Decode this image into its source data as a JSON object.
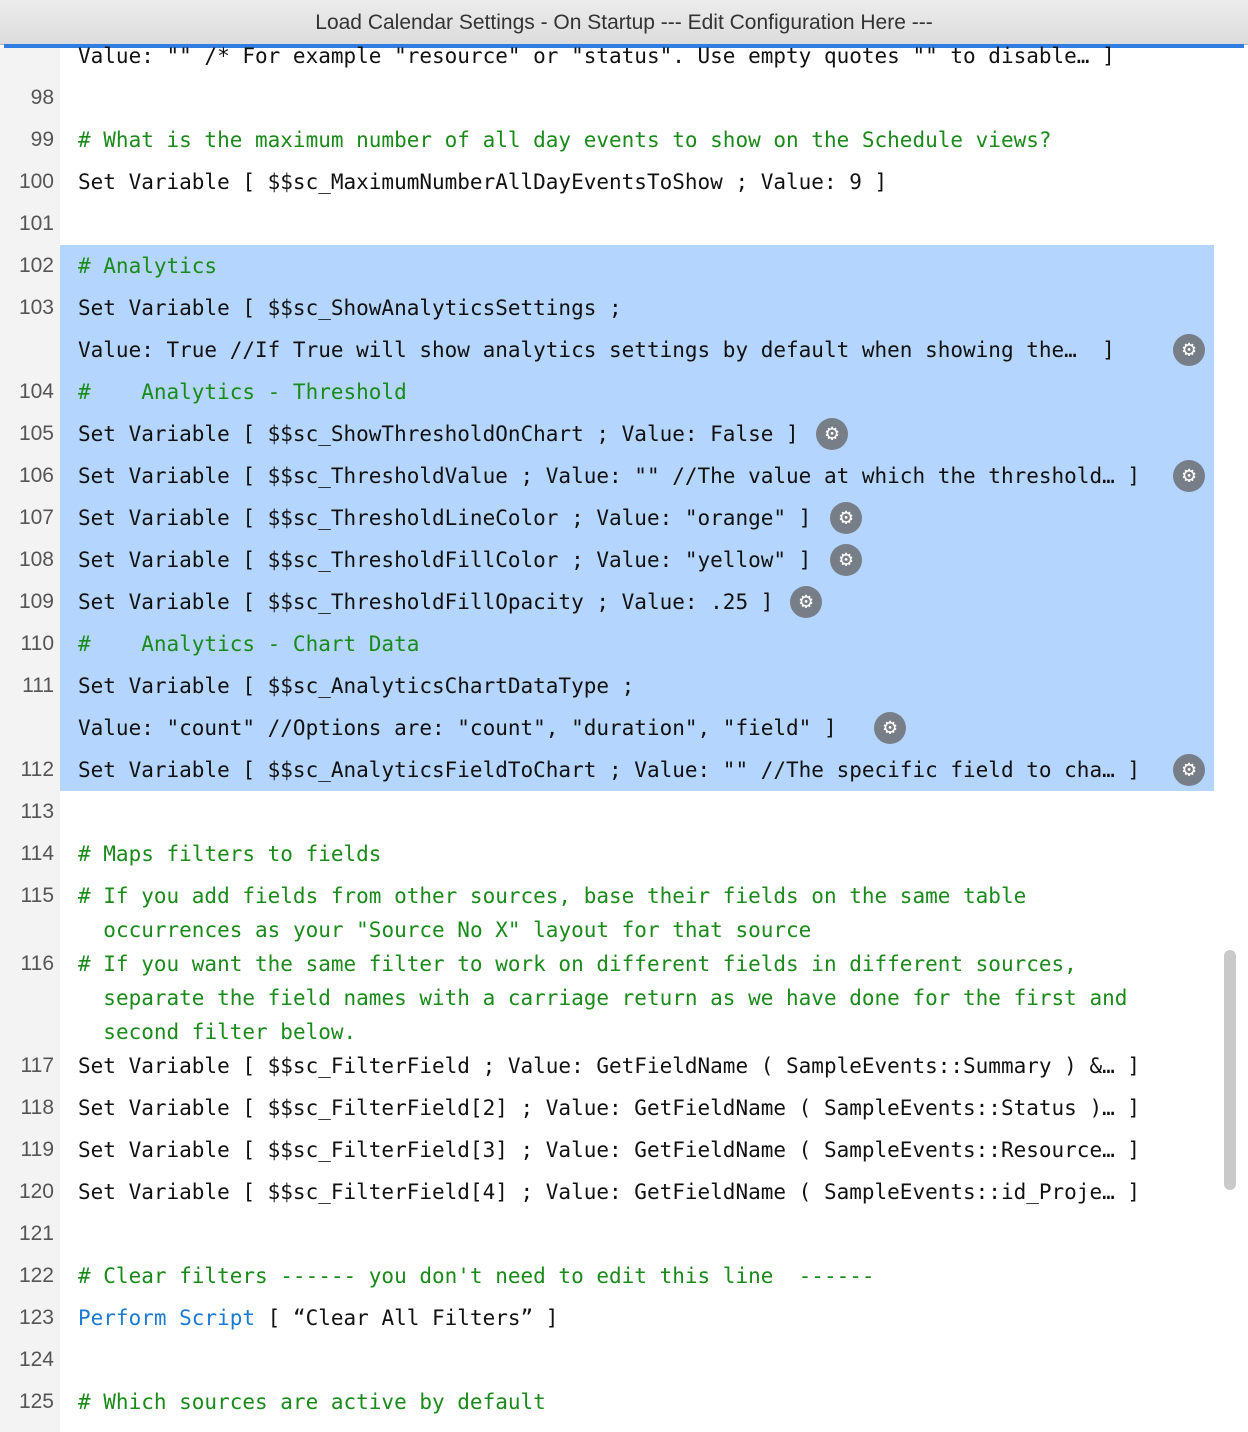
{
  "window": {
    "title": "Load Calendar Settings - On Startup --- Edit Configuration Here ---"
  },
  "lines": [
    {
      "num": "",
      "text": "Value: \"\" /* For example \"resource\" or \"status\". Use empty quotes \"\" to disable… ]"
    },
    {
      "num": "98",
      "text": ""
    },
    {
      "num": "99",
      "text": "# What is the maximum number of all day events to show on the Schedule views?"
    },
    {
      "num": "100",
      "text": "Set Variable [ $$sc_MaximumNumberAllDayEventsToShow ; Value: 9 ]"
    },
    {
      "num": "101",
      "text": ""
    },
    {
      "num": "102",
      "text": "# Analytics"
    },
    {
      "num": "103",
      "text": "Set Variable [ $$sc_ShowAnalyticsSettings ;"
    },
    {
      "num": "",
      "text": "Value: True //If True will show analytics settings by default when showing the…  ]"
    },
    {
      "num": "104",
      "text": "#    Analytics - Threshold"
    },
    {
      "num": "105",
      "text": "Set Variable [ $$sc_ShowThresholdOnChart ; Value: False ]"
    },
    {
      "num": "106",
      "text": "Set Variable [ $$sc_ThresholdValue ; Value: \"\" //The value at which the threshold… ]"
    },
    {
      "num": "107",
      "text": "Set Variable [ $$sc_ThresholdLineColor ; Value: \"orange\" ]"
    },
    {
      "num": "108",
      "text": "Set Variable [ $$sc_ThresholdFillColor ; Value: \"yellow\" ]"
    },
    {
      "num": "109",
      "text": "Set Variable [ $$sc_ThresholdFillOpacity ; Value: .25 ]"
    },
    {
      "num": "110",
      "text": "#    Analytics - Chart Data"
    },
    {
      "num": "111",
      "text": "Set Variable [ $$sc_AnalyticsChartDataType ;"
    },
    {
      "num": "",
      "text": "Value: \"count\" //Options are: \"count\", \"duration\", \"field\" ]"
    },
    {
      "num": "112",
      "text": "Set Variable [ $$sc_AnalyticsFieldToChart ; Value: \"\" //The specific field to cha… ]"
    },
    {
      "num": "113",
      "text": ""
    },
    {
      "num": "114",
      "text": "# Maps filters to fields"
    },
    {
      "num": "115",
      "text": "# If you add fields from other sources, base their fields on the same table\n  occurrences as your \"Source No X\" layout for that source"
    },
    {
      "num": "116",
      "text": "# If you want the same filter to work on different fields in different sources,\n  separate the field names with a carriage return as we have done for the first and\n  second filter below."
    },
    {
      "num": "117",
      "text": "Set Variable [ $$sc_FilterField ; Value: GetFieldName ( SampleEvents::Summary ) &… ]"
    },
    {
      "num": "118",
      "text": "Set Variable [ $$sc_FilterField[2] ; Value: GetFieldName ( SampleEvents::Status )… ]"
    },
    {
      "num": "119",
      "text": "Set Variable [ $$sc_FilterField[3] ; Value: GetFieldName ( SampleEvents::Resource… ]"
    },
    {
      "num": "120",
      "text": "Set Variable [ $$sc_FilterField[4] ; Value: GetFieldName ( SampleEvents::id_Proje… ]"
    },
    {
      "num": "121",
      "text": ""
    },
    {
      "num": "122",
      "text": "# Clear filters ------ you don't need to edit this line  ------"
    },
    {
      "num": "123",
      "text": "Perform Script [ “Clear All Filters” ]"
    },
    {
      "num": "124",
      "text": ""
    },
    {
      "num": "125",
      "text": "# Which sources are active by default"
    }
  ],
  "icons": {
    "gear": "gear-icon"
  },
  "colors": {
    "selection": "#b4d5fe",
    "comment": "#1a8a1a",
    "keyword": "#1a7ad4",
    "accent": "#2f7de1"
  }
}
